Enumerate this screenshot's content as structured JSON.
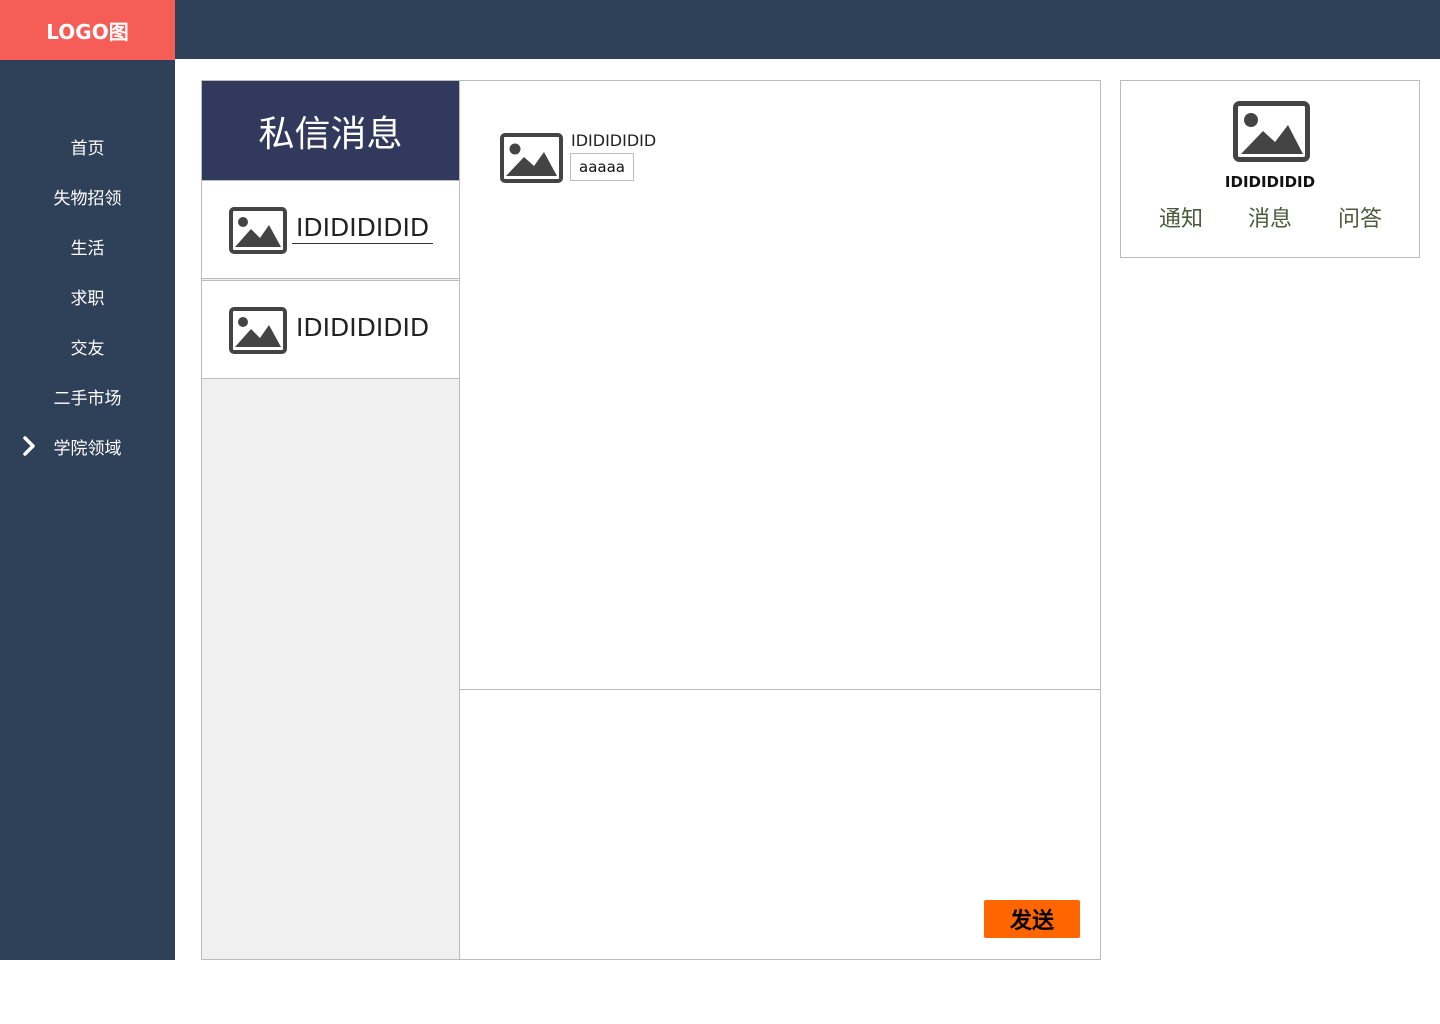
{
  "logo": {
    "text": "LOGO图"
  },
  "sidebar": {
    "items": [
      {
        "label": "首页"
      },
      {
        "label": "失物招领"
      },
      {
        "label": "生活"
      },
      {
        "label": "求职"
      },
      {
        "label": "交友"
      },
      {
        "label": "二手市场"
      },
      {
        "label": "学院领域"
      }
    ]
  },
  "messages_panel": {
    "title": "私信消息",
    "contacts": [
      {
        "name": "IDIDIDIDID"
      },
      {
        "name": "IDIDIDIDID"
      }
    ]
  },
  "chat": {
    "messages": [
      {
        "user": "IDIDIDIDID",
        "text": "aaaaa"
      }
    ],
    "send_label": "发送"
  },
  "profile": {
    "name": "IDIDIDIDID",
    "tabs": [
      {
        "label": "通知"
      },
      {
        "label": "消息"
      },
      {
        "label": "问答"
      }
    ]
  },
  "colors": {
    "logo_bg": "#f65d57",
    "nav_bg": "#2f4059",
    "panel_header_bg": "#313a5c",
    "send_button": "#ff6600"
  }
}
